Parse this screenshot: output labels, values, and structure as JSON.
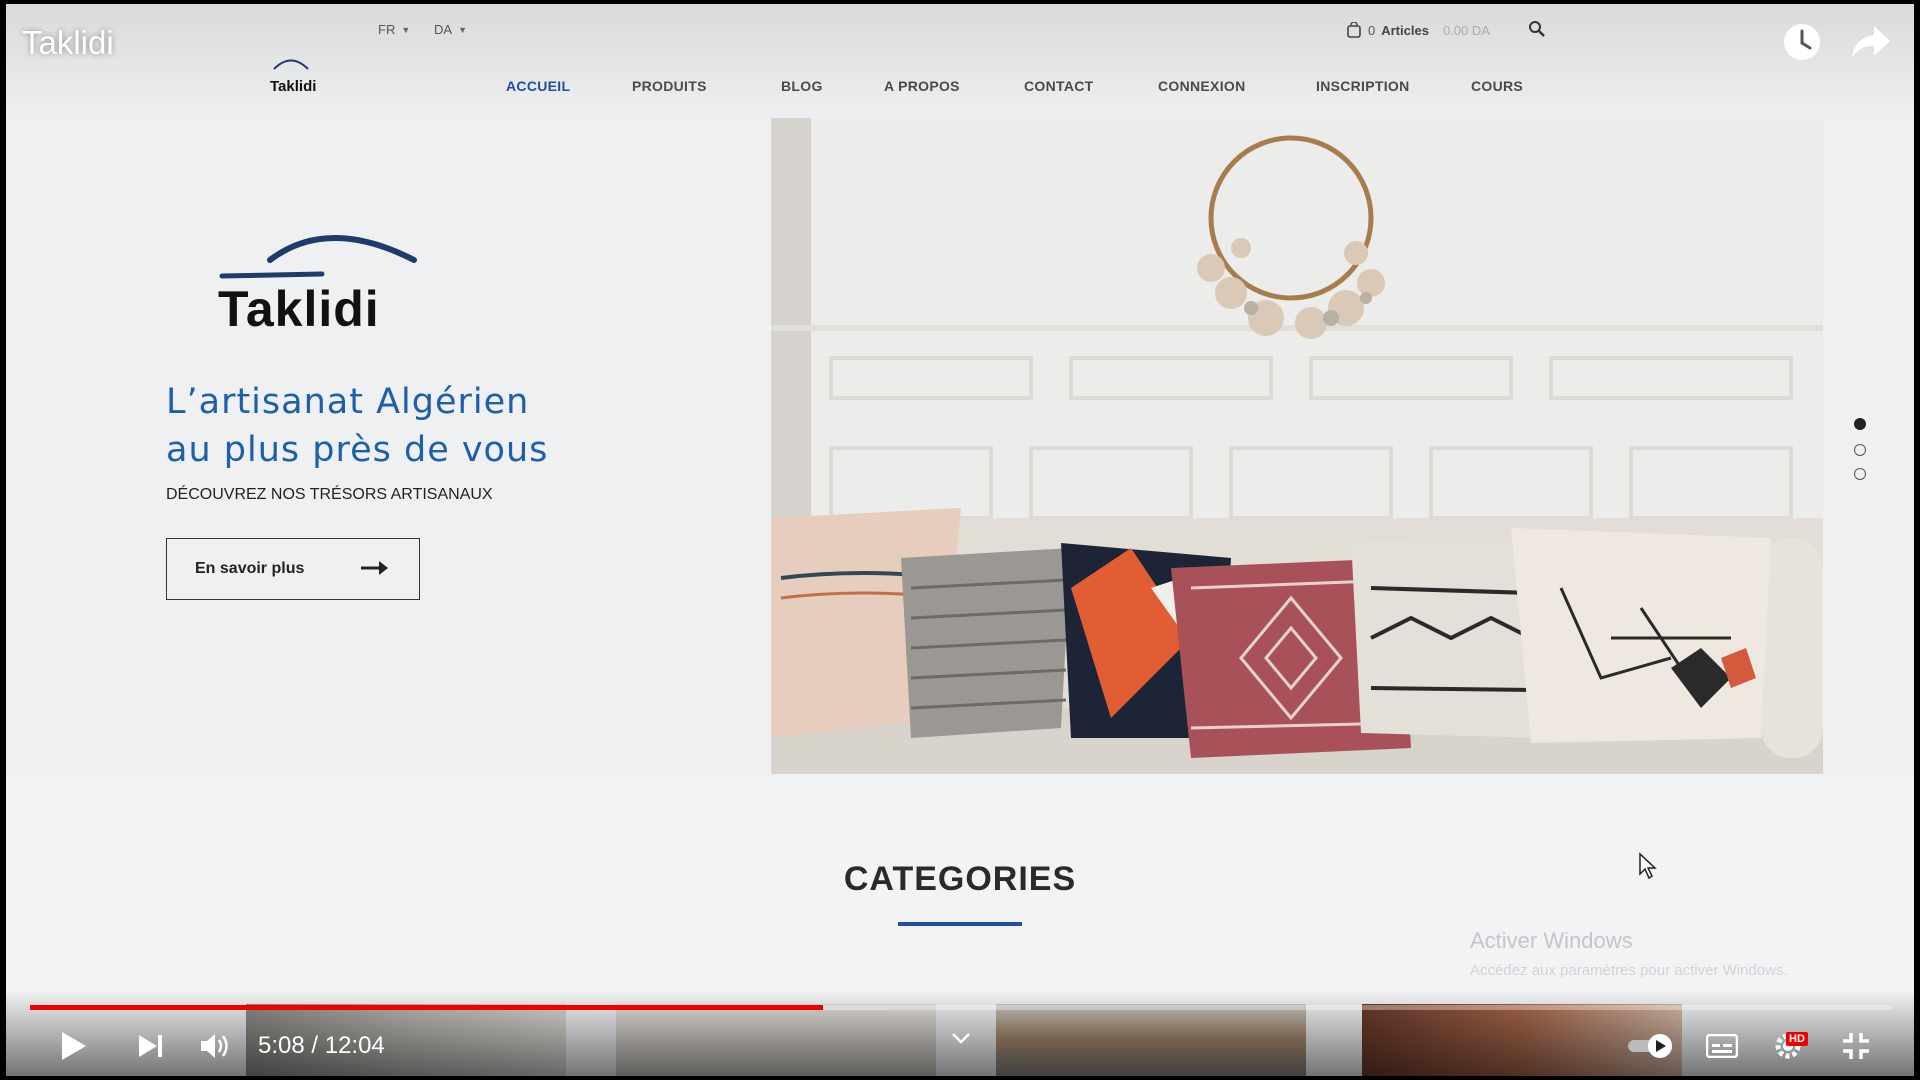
{
  "video": {
    "title": "Taklidi",
    "time_current": "5:08",
    "time_total": "12:04",
    "time_display": "5:08 / 12:04",
    "progress": 0.426,
    "buffered": 0.463,
    "hd_badge": "HD",
    "accent_color": "#ee0000"
  },
  "site": {
    "topbar": {
      "language": "FR",
      "currency": "DA",
      "cart_count": "0",
      "cart_label": "Articles",
      "cart_total": "0.00 DA"
    },
    "logo_text": "Taklidi",
    "nav": [
      {
        "label": "ACCUEIL",
        "active": true
      },
      {
        "label": "PRODUITS",
        "active": false
      },
      {
        "label": "BLOG",
        "active": false
      },
      {
        "label": "A PROPOS",
        "active": false
      },
      {
        "label": "CONTACT",
        "active": false
      },
      {
        "label": "CONNEXION",
        "active": false
      },
      {
        "label": "INSCRIPTION",
        "active": false
      },
      {
        "label": "COURS",
        "active": false
      }
    ],
    "hero": {
      "title_line1": "L’artisanat Algérien",
      "title_line2": "au plus près de vous",
      "subtitle": "DÉCOUVREZ NOS TRÉSORS ARTISANAUX",
      "button_label": "En savoir plus",
      "slides": 3,
      "active_slide": 1
    },
    "categories_title": "CATEGORIES",
    "brand_color": "#1f4f9c",
    "hero_title_color": "#1f5ea8"
  },
  "watermark": {
    "title": "Activer Windows",
    "subtitle": "Accédez aux paramètres pour activer Windows."
  },
  "icons": [
    "cart-icon",
    "search-icon",
    "clock-icon",
    "share-icon",
    "play-icon",
    "next-icon",
    "volume-icon",
    "autoplay-icon",
    "subtitles-icon",
    "settings-icon",
    "fullscreen-exit-icon",
    "arrow-right-icon"
  ]
}
